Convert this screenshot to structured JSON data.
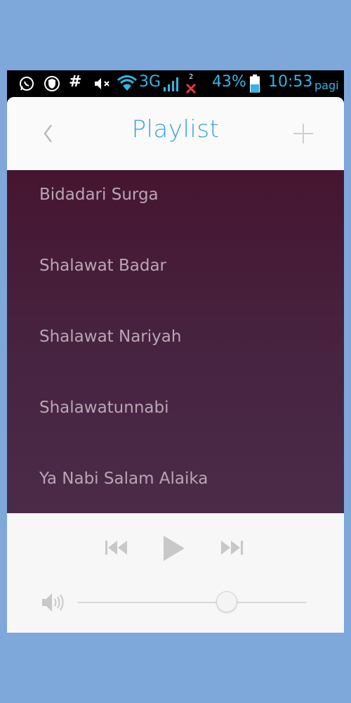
{
  "status_bar": {
    "battery_percent": "43%",
    "network_type": "3G",
    "time": "10:53",
    "period": "pagi",
    "notification_count": "2",
    "icons": [
      "whatsapp-icon",
      "shield-icon",
      "hash-icon",
      "mute-icon",
      "wifi-icon",
      "signal-icon",
      "no-sim-icon",
      "battery-icon"
    ]
  },
  "header": {
    "title": "Playlist",
    "back_icon": "chevron-left-icon",
    "add_icon": "plus-icon"
  },
  "playlist": {
    "items": [
      {
        "label": "Bidadari Surga"
      },
      {
        "label": "Shalawat Badar"
      },
      {
        "label": "Shalawat Nariyah"
      },
      {
        "label": "Shalawatunnabi"
      },
      {
        "label": "Ya Nabi Salam Alaika"
      }
    ]
  },
  "player": {
    "icons": [
      "previous-icon",
      "play-icon",
      "next-icon",
      "volume-icon"
    ],
    "volume_level": 0.65
  },
  "colors": {
    "background": "#7ea7da",
    "accent": "#3aa3df",
    "list_top": "#461530",
    "list_bottom": "#4a2b48",
    "list_text": "#b9a6b4"
  }
}
